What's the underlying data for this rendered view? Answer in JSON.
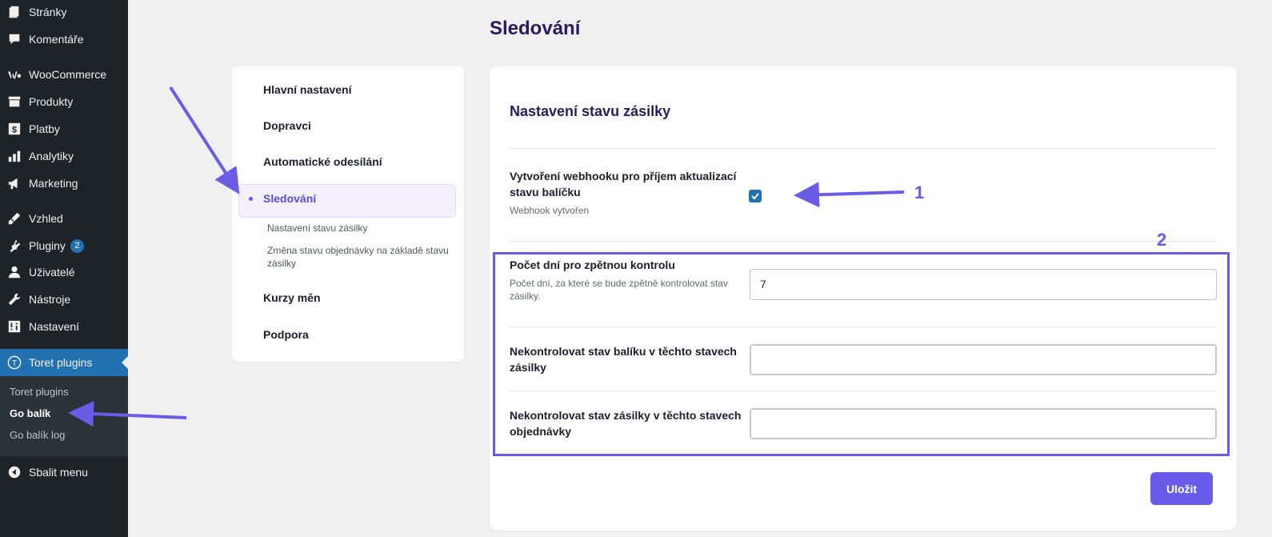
{
  "wp_menu": {
    "items": [
      {
        "label": "Stránky",
        "icon": "pages-icon"
      },
      {
        "label": "Komentáře",
        "icon": "comments-icon"
      },
      {
        "label": "WooCommerce",
        "icon": "woocommerce-icon"
      },
      {
        "label": "Produkty",
        "icon": "products-icon"
      },
      {
        "label": "Platby",
        "icon": "payments-icon"
      },
      {
        "label": "Analytiky",
        "icon": "analytics-icon"
      },
      {
        "label": "Marketing",
        "icon": "marketing-icon"
      },
      {
        "label": "Vzhled",
        "icon": "appearance-icon"
      },
      {
        "label": "Pluginy",
        "icon": "plugins-icon",
        "badge": "2"
      },
      {
        "label": "Uživatelé",
        "icon": "users-icon"
      },
      {
        "label": "Nástroje",
        "icon": "tools-icon"
      },
      {
        "label": "Nastavení",
        "icon": "settings-icon"
      },
      {
        "label": "Toret plugins",
        "icon": "toret-icon"
      }
    ],
    "submenu": [
      "Toret plugins",
      "Go balík",
      "Go balík log"
    ],
    "collapse": "Sbalit menu"
  },
  "page": {
    "title": "Sledování"
  },
  "settings_nav": {
    "links": [
      "Hlavní nastavení",
      "Dopravci",
      "Automatické odesílání",
      "Sledování",
      "Kurzy měn",
      "Podpora"
    ],
    "sub_links": [
      "Nastavení stavu zásilky",
      "Změna stavu objednávky na základě stavu zásilky"
    ]
  },
  "main": {
    "section_title": "Nastavení stavu zásilky",
    "webhook": {
      "label": "Vytvoření webhooku pro příjem aktualizací stavu balíčku",
      "help": "Webhook vytvořen",
      "checked": true
    },
    "days": {
      "label": "Počet dní pro zpětnou kontrolu",
      "help": "Počet dní, za které se bude zpětně kontrolovat stav zásilky.",
      "value": "7"
    },
    "skip_package_states": {
      "label": "Nekontrolovat stav balíku v těchto stavech zásilky",
      "value": ""
    },
    "skip_order_states": {
      "label": "Nekontrolovat stav zásilky v těchto stavech objednávky",
      "value": ""
    },
    "save_label": "Uložit"
  },
  "annotations": {
    "one": "1",
    "two": "2"
  },
  "colors": {
    "accent": "#6b5ce7",
    "wp_sidebar": "#1d2327",
    "wp_active": "#2271b1",
    "title": "#2a1a5e"
  }
}
